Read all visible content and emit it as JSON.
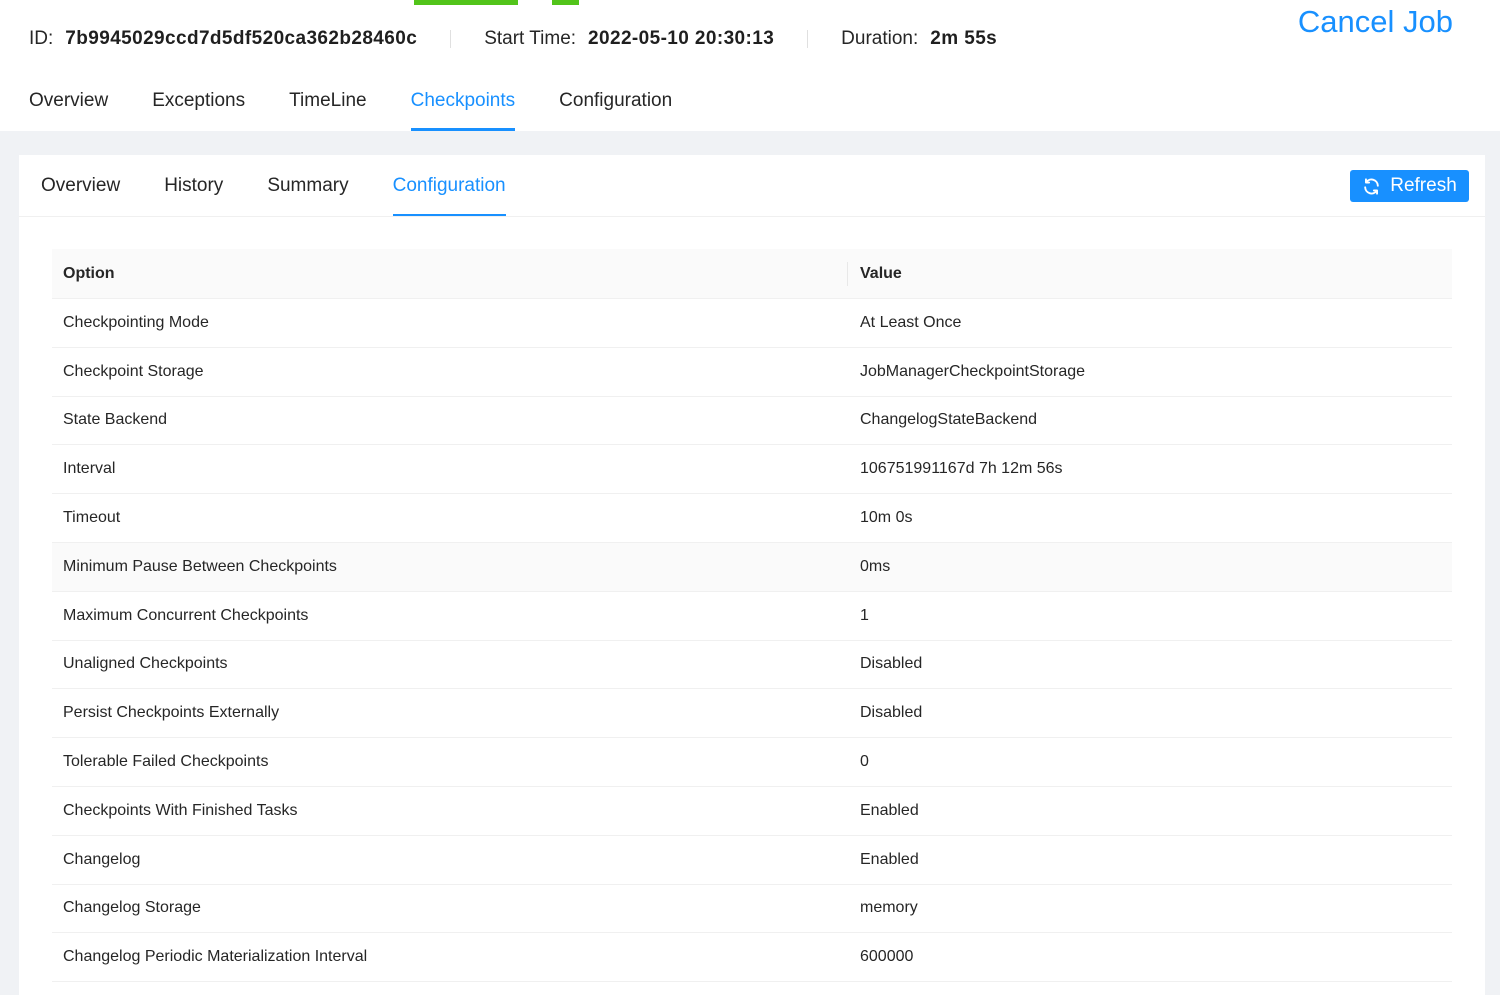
{
  "job": {
    "id_label": "ID:",
    "id_value": "7b9945029ccd7d5df520ca362b28460c",
    "start_label": "Start Time:",
    "start_value": "2022-05-10 20:30:13",
    "duration_label": "Duration:",
    "duration_value": "2m 55s",
    "cancel_label": "Cancel Job"
  },
  "job_tabs": [
    {
      "label": "Overview",
      "active": false
    },
    {
      "label": "Exceptions",
      "active": false
    },
    {
      "label": "TimeLine",
      "active": false
    },
    {
      "label": "Checkpoints",
      "active": true
    },
    {
      "label": "Configuration",
      "active": false
    }
  ],
  "sub_tabs": [
    {
      "label": "Overview",
      "active": false
    },
    {
      "label": "History",
      "active": false
    },
    {
      "label": "Summary",
      "active": false
    },
    {
      "label": "Configuration",
      "active": true
    }
  ],
  "refresh": {
    "label": "Refresh",
    "icon": "sync-icon"
  },
  "table": {
    "headers": {
      "option": "Option",
      "value": "Value"
    },
    "rows": [
      {
        "option": "Checkpointing Mode",
        "value": "At Least Once"
      },
      {
        "option": "Checkpoint Storage",
        "value": "JobManagerCheckpointStorage"
      },
      {
        "option": "State Backend",
        "value": "ChangelogStateBackend"
      },
      {
        "option": "Interval",
        "value": "106751991167d 7h 12m 56s"
      },
      {
        "option": "Timeout",
        "value": "10m 0s"
      },
      {
        "option": "Minimum Pause Between Checkpoints",
        "value": "0ms"
      },
      {
        "option": "Maximum Concurrent Checkpoints",
        "value": "1"
      },
      {
        "option": "Unaligned Checkpoints",
        "value": "Disabled"
      },
      {
        "option": "Persist Checkpoints Externally",
        "value": "Disabled"
      },
      {
        "option": "Tolerable Failed Checkpoints",
        "value": "0"
      },
      {
        "option": "Checkpoints With Finished Tasks",
        "value": "Enabled"
      },
      {
        "option": "Changelog",
        "value": "Enabled"
      },
      {
        "option": "Changelog Storage",
        "value": "memory"
      },
      {
        "option": "Changelog Periodic Materialization Interval",
        "value": "600000"
      }
    ]
  },
  "colors": {
    "accent": "#1890ff",
    "status_green": "#52c41a"
  }
}
